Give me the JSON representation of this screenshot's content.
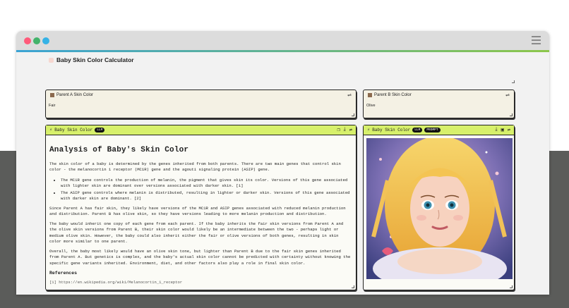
{
  "app": {
    "title": "Baby Skin Color Calculator"
  },
  "colors": {
    "window_dot_red": "#ff5a7a",
    "window_dot_yellow": "#43b36b",
    "window_dot_green": "#35b2e6",
    "accent_left": "#3ba3d4",
    "accent_right": "#8cc64a",
    "node_header": "#d7f06b"
  },
  "inputs": [
    {
      "label": "Parent A Skin Color",
      "value": "Fair"
    },
    {
      "label": "Parent B Skin Color",
      "value": "Olive"
    }
  ],
  "text_output": {
    "title": "Baby Skin Color",
    "badges": [
      "LLM"
    ],
    "icons": [
      "copy-icon",
      "download-icon",
      "settings-icon"
    ],
    "heading": "Analysis of Baby's Skin Color",
    "paragraphs": [
      "The skin color of a baby is determined by the genes inherited from both parents. There are two main genes that control skin color - the melanocortin 1 receptor (MC1R) gene and the agouti signaling protein (ASIP) gene."
    ],
    "bullets": [
      "The MC1R gene controls the production of melanin, the pigment that gives skin its color. Versions of this gene associated with lighter skin are dominant over versions associated with darker skin. [1]",
      "The ASIP gene controls where melanin is distributed, resulting in lighter or darker skin. Versions of this gene associated with darker skin are dominant. [2]"
    ],
    "paragraphs_after": [
      "Since Parent A has fair skin, they likely have versions of the MC1R and ASIP genes associated with reduced melanin production and distribution. Parent B has olive skin, so they have versions leading to more melanin production and distribution.",
      "The baby would inherit one copy of each gene from each parent. If the baby inherits the fair skin versions from Parent A and the olive skin versions from Parent B, their skin color would likely be an intermediate between the two - perhaps light or medium olive skin. However, the baby could also inherit either the fair or olive versions of both genes, resulting in skin color more similar to one parent.",
      "Overall, the baby most likely would have an olive skin tone, but lighter than Parent B due to the fair skin genes inherited from Parent A. But genetics is complex, and the baby's actual skin color cannot be predicted with certainty without knowing the specific gene variants inherited. Environment, diet, and other factors also play a role in final skin color."
    ],
    "references_heading": "References",
    "reference_1": "[1] https://en.wikipedia.org/wiki/Melanocortin_1_receptor"
  },
  "image_output": {
    "title": "Baby Skin Color",
    "badges": [
      "LLM",
      "PROMPT"
    ],
    "icons": [
      "download-icon",
      "image-icon",
      "settings-icon"
    ]
  }
}
